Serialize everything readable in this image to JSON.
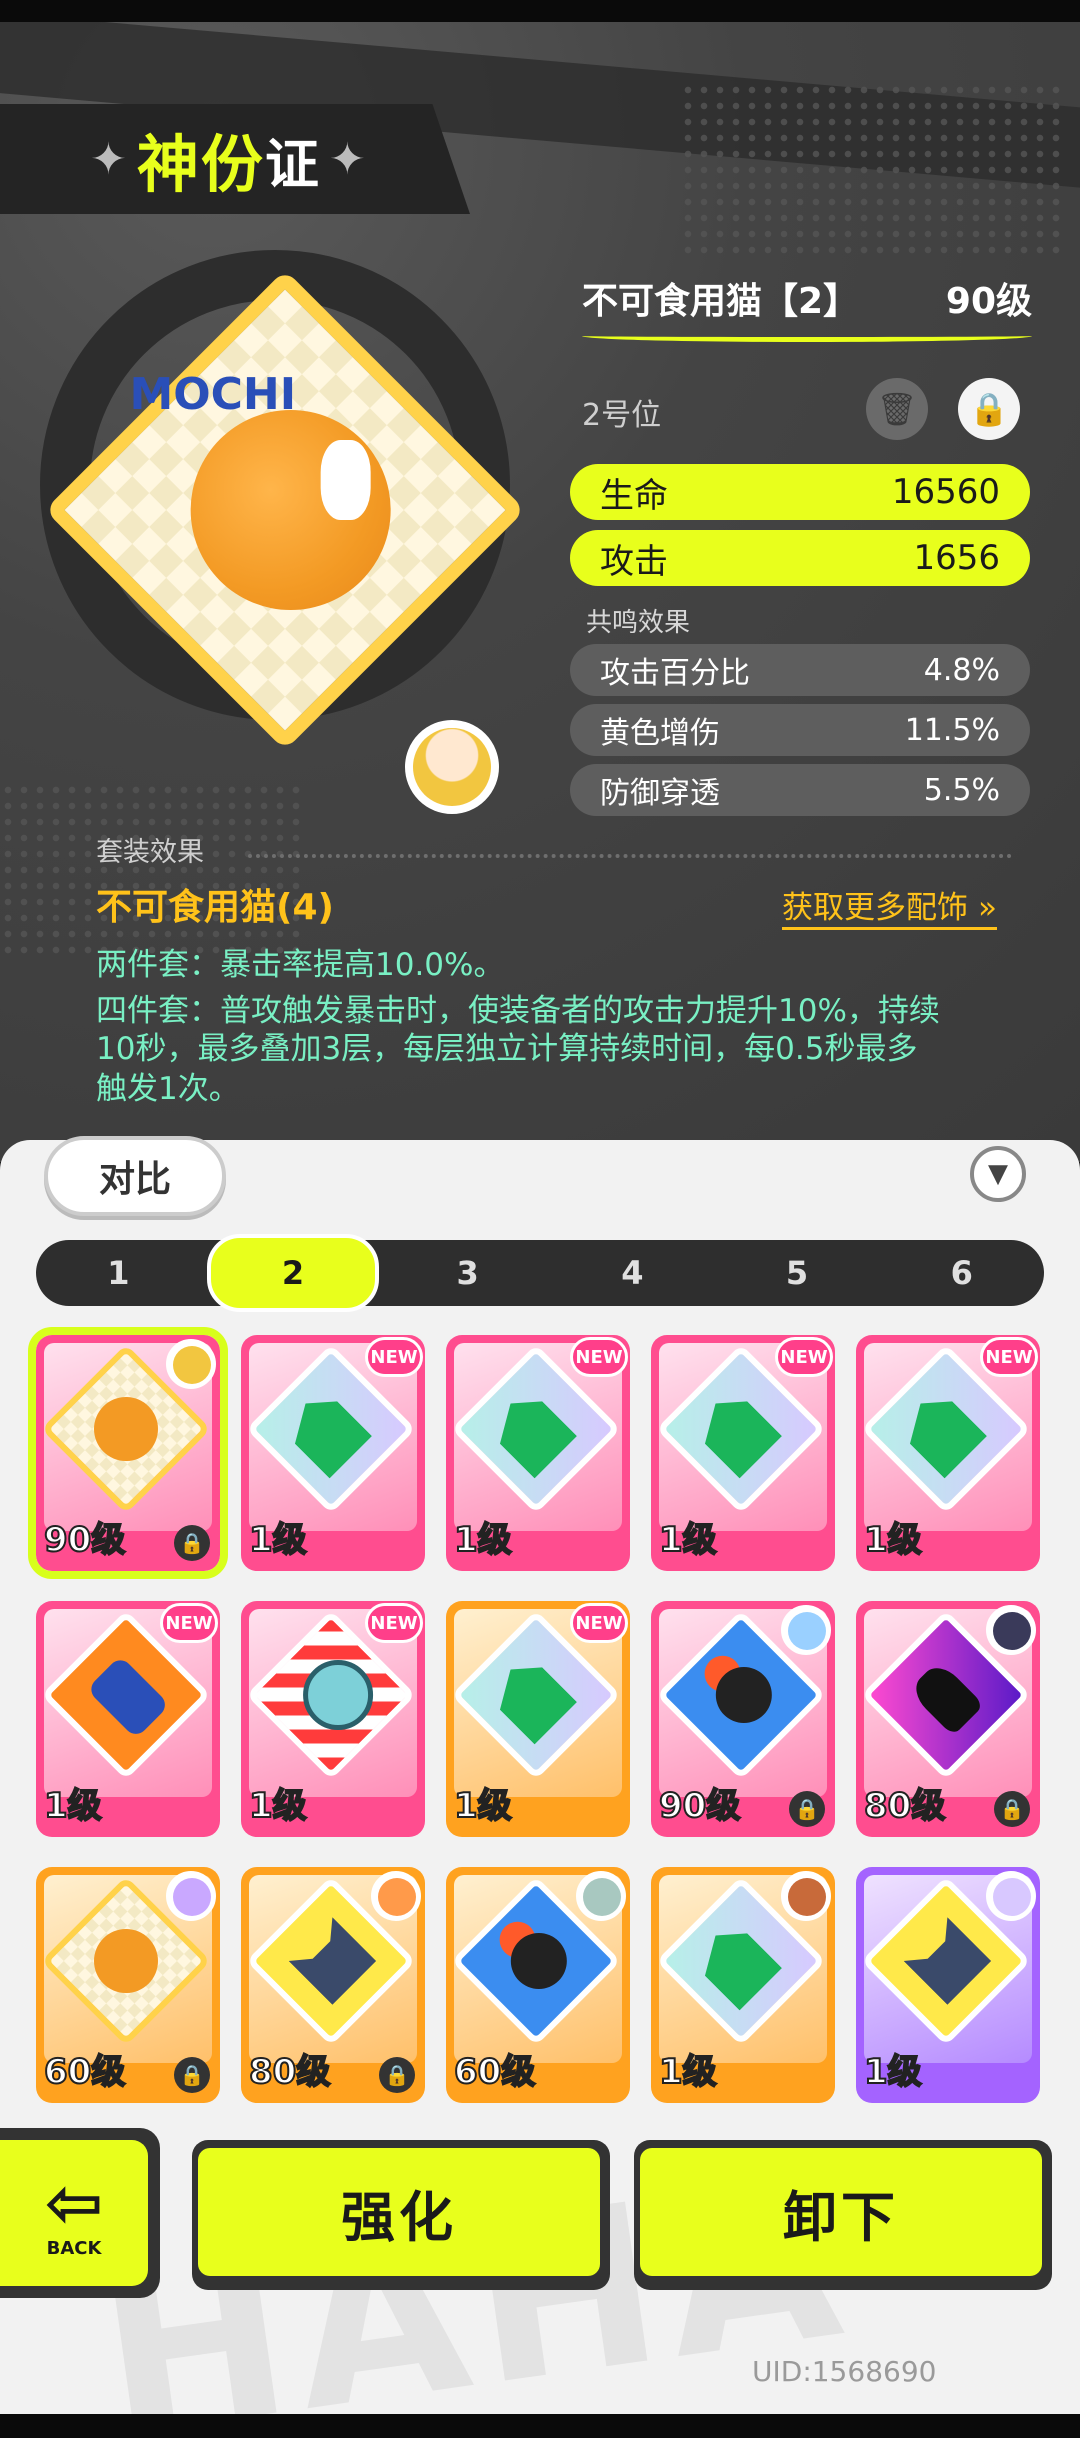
{
  "header": {
    "title_highlight": "神份",
    "title_rest": "证"
  },
  "disk": {
    "art_text": "MOCHI",
    "name": "不可食用猫【2】",
    "level": "90级",
    "slot": "2号位",
    "main_stats": [
      {
        "label": "生命",
        "value": "16560"
      },
      {
        "label": "攻击",
        "value": "1656"
      }
    ],
    "resonance_title": "共鸣效果",
    "sub_stats": [
      {
        "label": "攻击百分比",
        "value": "4.8%"
      },
      {
        "label": "黄色增伤",
        "value": "11.5%"
      },
      {
        "label": "防御穿透",
        "value": "5.5%"
      }
    ]
  },
  "set_bonus": {
    "title": "套装效果",
    "name": "不可食用猫(4)",
    "more_link": "获取更多配饰",
    "desc_lines": [
      "两件套：暴击率提高10.0%。",
      "四件套：普攻触发暴击时，使装备者的攻击力提升10%，持续",
      "10秒，最多叠加3层，每层独立计算持续时间，每0.5秒最多",
      "触发1次。"
    ]
  },
  "compare_label": "对比",
  "tabs": [
    "1",
    "2",
    "3",
    "4",
    "5",
    "6"
  ],
  "active_tab": "2",
  "grid": [
    {
      "level": "90级",
      "art": "mochi",
      "frame": "pink",
      "new": false,
      "avatar": "#f2c640",
      "lock": true,
      "selected": true
    },
    {
      "level": "1级",
      "art": "green",
      "frame": "pink",
      "new": true
    },
    {
      "level": "1级",
      "art": "green",
      "frame": "pink",
      "new": true
    },
    {
      "level": "1级",
      "art": "green",
      "frame": "pink",
      "new": true
    },
    {
      "level": "1级",
      "art": "green",
      "frame": "pink",
      "new": true
    },
    {
      "level": "1级",
      "art": "hand",
      "frame": "pink",
      "new": true
    },
    {
      "level": "1级",
      "art": "clock",
      "frame": "pink",
      "new": true
    },
    {
      "level": "1级",
      "art": "green",
      "frame": "orange",
      "new": true
    },
    {
      "level": "90级",
      "art": "kill",
      "frame": "pink",
      "new": false,
      "avatar": "#9ad0ff",
      "lock": true
    },
    {
      "level": "80级",
      "art": "angel",
      "frame": "pink",
      "new": false,
      "avatar": "#3a3a5a",
      "lock": true
    },
    {
      "level": "60级",
      "art": "mochi",
      "frame": "orange",
      "new": false,
      "avatar": "#c9a8ff",
      "lock": true
    },
    {
      "level": "80级",
      "art": "catsuit",
      "frame": "orange",
      "new": false,
      "avatar": "#ff9a4a",
      "lock": true
    },
    {
      "level": "60级",
      "art": "kill",
      "frame": "orange",
      "new": false,
      "avatar": "#a8c8c0"
    },
    {
      "level": "1级",
      "art": "green",
      "frame": "orange",
      "new": false,
      "avatar": "#c86a3a"
    },
    {
      "level": "1级",
      "art": "catsuit",
      "frame": "purple",
      "new": false,
      "avatar": "#d8c8ff"
    }
  ],
  "new_badge": "NEW",
  "buttons": {
    "back": "BACK",
    "enhance": "强化",
    "unequip": "卸下"
  },
  "uid": "UID:1568690",
  "icons": {
    "trash": "trash-icon",
    "lock": "lock-icon",
    "filter": "filter-icon",
    "chevrons": "double-chevron-right-icon"
  },
  "colors": {
    "accent": "#e8ff1c",
    "set_name": "#ffc21a",
    "desc": "#79f0c4",
    "pink": "#ff4d8f",
    "orange": "#ffa21f",
    "purple": "#a463ff"
  }
}
